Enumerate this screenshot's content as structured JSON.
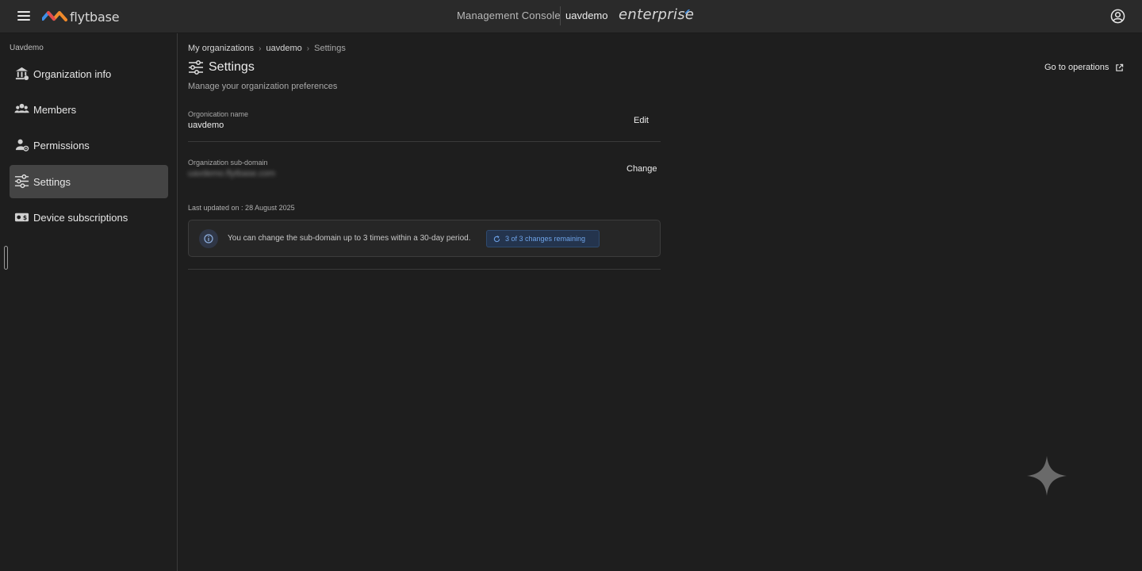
{
  "header": {
    "brand": "flytbase",
    "console_title": "Management Console",
    "org_name": "uavdemo",
    "edition": "enterprise"
  },
  "sidebar": {
    "org_label": "Uavdemo",
    "items": [
      {
        "label": "Organization info",
        "icon": "building-icon",
        "active": false
      },
      {
        "label": "Members",
        "icon": "users-icon",
        "active": false
      },
      {
        "label": "Permissions",
        "icon": "user-key-icon",
        "active": false
      },
      {
        "label": "Settings",
        "icon": "sliders-icon",
        "active": true
      },
      {
        "label": "Device subscriptions",
        "icon": "subscription-icon",
        "active": false
      }
    ]
  },
  "breadcrumb": [
    "My organizations",
    "uavdemo",
    "Settings"
  ],
  "page": {
    "title": "Settings",
    "subtitle": "Manage your organization preferences",
    "go_to_operations": "Go to operations"
  },
  "org_name_field": {
    "label": "Orgonication name",
    "value": "uavdemo",
    "action": "Edit"
  },
  "subdomain_field": {
    "label": "Organization sub-domain",
    "value": "uavdemo.flytbase.com",
    "action": "Change"
  },
  "last_updated": "Last updated on : 28 August 2025",
  "info": {
    "text": "You can change the sub-domain up to 3 times within a 30-day period.",
    "badge": "3 of 3 changes remaining"
  },
  "colors": {
    "accent": "#6ea3e8",
    "active_nav": "#444444",
    "background": "#1e1e1e"
  }
}
